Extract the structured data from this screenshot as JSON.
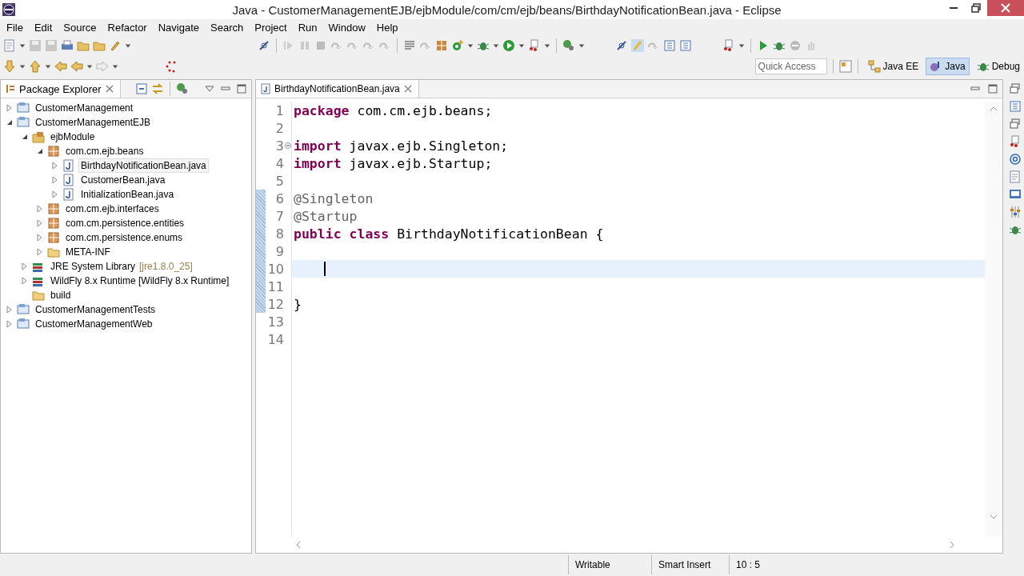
{
  "window": {
    "title": "Java - CustomerManagementEJB/ejbModule/com/cm/ejb/beans/BirthdayNotificationBean.java - Eclipse"
  },
  "menu": [
    "File",
    "Edit",
    "Source",
    "Refactor",
    "Navigate",
    "Search",
    "Project",
    "Run",
    "Window",
    "Help"
  ],
  "quick_access": {
    "placeholder": "Quick Access"
  },
  "perspectives": [
    {
      "label": "Java EE",
      "selected": false
    },
    {
      "label": "Java",
      "selected": true
    },
    {
      "label": "Debug",
      "selected": false
    }
  ],
  "package_explorer": {
    "title": "Package Explorer",
    "tree": [
      {
        "label": "CustomerManagement",
        "kind": "project",
        "expanded": false,
        "selected": false
      },
      {
        "label": "CustomerManagementEJB",
        "kind": "project",
        "expanded": true,
        "selected": false,
        "children": [
          {
            "label": "ejbModule",
            "kind": "source",
            "expanded": true,
            "selected": false,
            "children": [
              {
                "label": "com.cm.ejb.beans",
                "kind": "package",
                "expanded": true,
                "selected": false,
                "children": [
                  {
                    "label": "BirthdayNotificationBean.java",
                    "kind": "java",
                    "expanded": false,
                    "selected": true
                  },
                  {
                    "label": "CustomerBean.java",
                    "kind": "java",
                    "expanded": false,
                    "selected": false
                  },
                  {
                    "label": "InitializationBean.java",
                    "kind": "java",
                    "expanded": false,
                    "selected": false
                  }
                ]
              },
              {
                "label": "com.cm.ejb.interfaces",
                "kind": "package",
                "expanded": false,
                "selected": false
              },
              {
                "label": "com.cm.persistence.entities",
                "kind": "package",
                "expanded": false,
                "selected": false
              },
              {
                "label": "com.cm.persistence.enums",
                "kind": "package",
                "expanded": false,
                "selected": false
              },
              {
                "label": "META-INF",
                "kind": "folder",
                "expanded": false,
                "selected": false
              }
            ]
          },
          {
            "label": "JRE System Library",
            "detail": "[jre1.8.0_25]",
            "kind": "library",
            "expanded": false,
            "selected": false
          },
          {
            "label": "WildFly 8.x Runtime [WildFly 8.x Runtime]",
            "kind": "library",
            "expanded": false,
            "selected": false
          },
          {
            "label": "build",
            "kind": "folder",
            "selected": false
          }
        ]
      },
      {
        "label": "CustomerManagementTests",
        "kind": "project",
        "expanded": false,
        "selected": false
      },
      {
        "label": "CustomerManagementWeb",
        "kind": "project",
        "expanded": false,
        "selected": false
      }
    ]
  },
  "editor": {
    "tab": "BirthdayNotificationBean.java",
    "lines": [
      {
        "number": "1",
        "tokens": [
          {
            "kind": "keyword",
            "text": "package"
          },
          {
            "kind": "plain",
            "text": " com.cm.ejb.beans;"
          }
        ]
      },
      {
        "number": "2"
      },
      {
        "number": "3",
        "fold": true,
        "tokens": [
          {
            "kind": "keyword",
            "text": "import"
          },
          {
            "kind": "plain",
            "text": " javax.ejb.Singleton;"
          }
        ]
      },
      {
        "number": "4",
        "tokens": [
          {
            "kind": "keyword",
            "text": "import"
          },
          {
            "kind": "plain",
            "text": " javax.ejb.Startup;"
          }
        ]
      },
      {
        "number": "5"
      },
      {
        "number": "6",
        "changed": true,
        "tokens": [
          {
            "kind": "annotation",
            "text": "@Singleton"
          }
        ]
      },
      {
        "number": "7",
        "changed": true,
        "tokens": [
          {
            "kind": "annotation",
            "text": "@Startup"
          }
        ]
      },
      {
        "number": "8",
        "changed": true,
        "tokens": [
          {
            "kind": "keyword",
            "text": "public class"
          },
          {
            "kind": "plain",
            "text": " BirthdayNotificationBean {"
          }
        ]
      },
      {
        "number": "9",
        "changed": true
      },
      {
        "number": "10",
        "changed": true,
        "current": true
      },
      {
        "number": "11",
        "changed": true
      },
      {
        "number": "12",
        "changed": true,
        "tokens": [
          {
            "kind": "plain",
            "text": "}"
          }
        ]
      },
      {
        "number": "13"
      },
      {
        "number": "14"
      }
    ]
  },
  "status_bar": [
    "Writable",
    "Smart Insert",
    "10 : 5"
  ]
}
